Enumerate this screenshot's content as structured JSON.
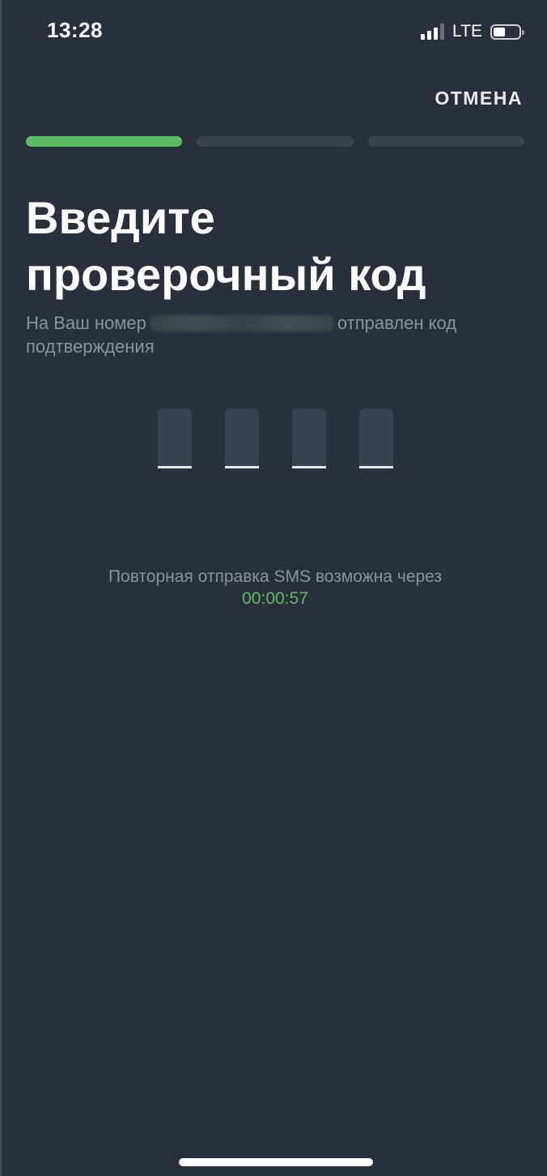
{
  "status_bar": {
    "time": "13:28",
    "network": "LTE",
    "signal_bars_active": 3,
    "signal_bars_total": 4,
    "battery_level": 0.4
  },
  "header": {
    "cancel_label": "ОТМЕНА"
  },
  "progress": {
    "steps_total": 3,
    "current_step": 1,
    "active_color": "#5dbb63",
    "inactive_color": "#3a4250"
  },
  "main": {
    "title": "Введите проверочный код",
    "subtitle_before": "На Ваш номер",
    "subtitle_after": "отправлен код подтверждения",
    "code_length": 4,
    "code_values": [
      "",
      "",
      "",
      ""
    ],
    "resend_text": "Повторная отправка SMS возможна через",
    "timer": "00:00:57",
    "accent_color": "#5dbb63"
  }
}
